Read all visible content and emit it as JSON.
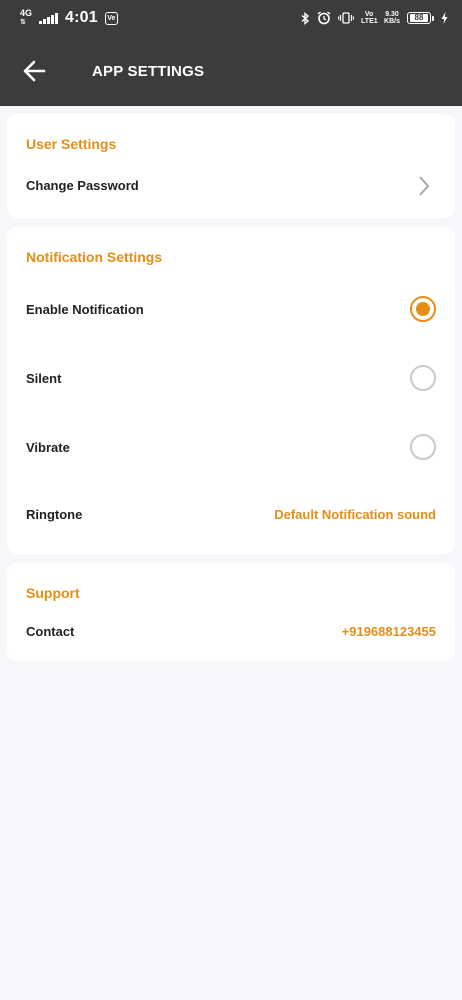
{
  "status_bar": {
    "network_type": "4G",
    "time": "4:01",
    "app_icon_text": "Ve",
    "volte_label": "Vo LTE1",
    "speed": "9.30",
    "speed_unit": "KB/s",
    "battery": "88"
  },
  "app_bar": {
    "title": "APP SETTINGS"
  },
  "user_settings": {
    "title": "User Settings",
    "change_password": "Change Password"
  },
  "notification_settings": {
    "title": "Notification Settings",
    "enable_notification": "Enable Notification",
    "enable_notification_selected": true,
    "silent": "Silent",
    "silent_selected": false,
    "vibrate": "Vibrate",
    "vibrate_selected": false,
    "ringtone_label": "Ringtone",
    "ringtone_value": "Default Notification sound"
  },
  "support": {
    "title": "Support",
    "contact_label": "Contact",
    "contact_value": "+919688123455"
  },
  "colors": {
    "accent": "#e58e14",
    "app_bar": "#3c3c3c",
    "background": "#f8f6fa"
  }
}
